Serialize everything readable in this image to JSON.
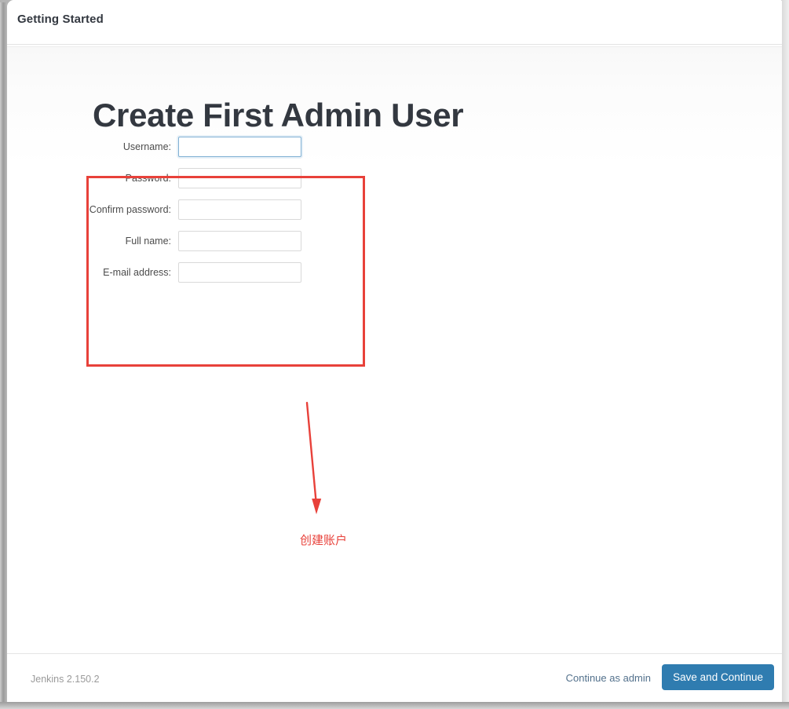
{
  "header": {
    "title": "Getting Started"
  },
  "main": {
    "page_title": "Create First Admin User",
    "form": {
      "fields": [
        {
          "label": "Username:",
          "name": "username",
          "type": "text",
          "value": "",
          "focused": true
        },
        {
          "label": "Password:",
          "name": "password",
          "type": "password",
          "value": "",
          "focused": false
        },
        {
          "label": "Confirm password:",
          "name": "confirm-password",
          "type": "password",
          "value": "",
          "focused": false
        },
        {
          "label": "Full name:",
          "name": "full-name",
          "type": "text",
          "value": "",
          "focused": false
        },
        {
          "label": "E-mail address:",
          "name": "email-address",
          "type": "text",
          "value": "",
          "focused": false
        }
      ]
    }
  },
  "annotations": {
    "box_color": "#e8413a",
    "arrow_color": "#e8413a",
    "caption": "创建账户"
  },
  "footer": {
    "version": "Jenkins 2.150.2",
    "continue_as_link": "Continue as admin",
    "save_button": "Save and Continue",
    "button_color": "#2f7cb0",
    "link_color": "#53718c"
  }
}
